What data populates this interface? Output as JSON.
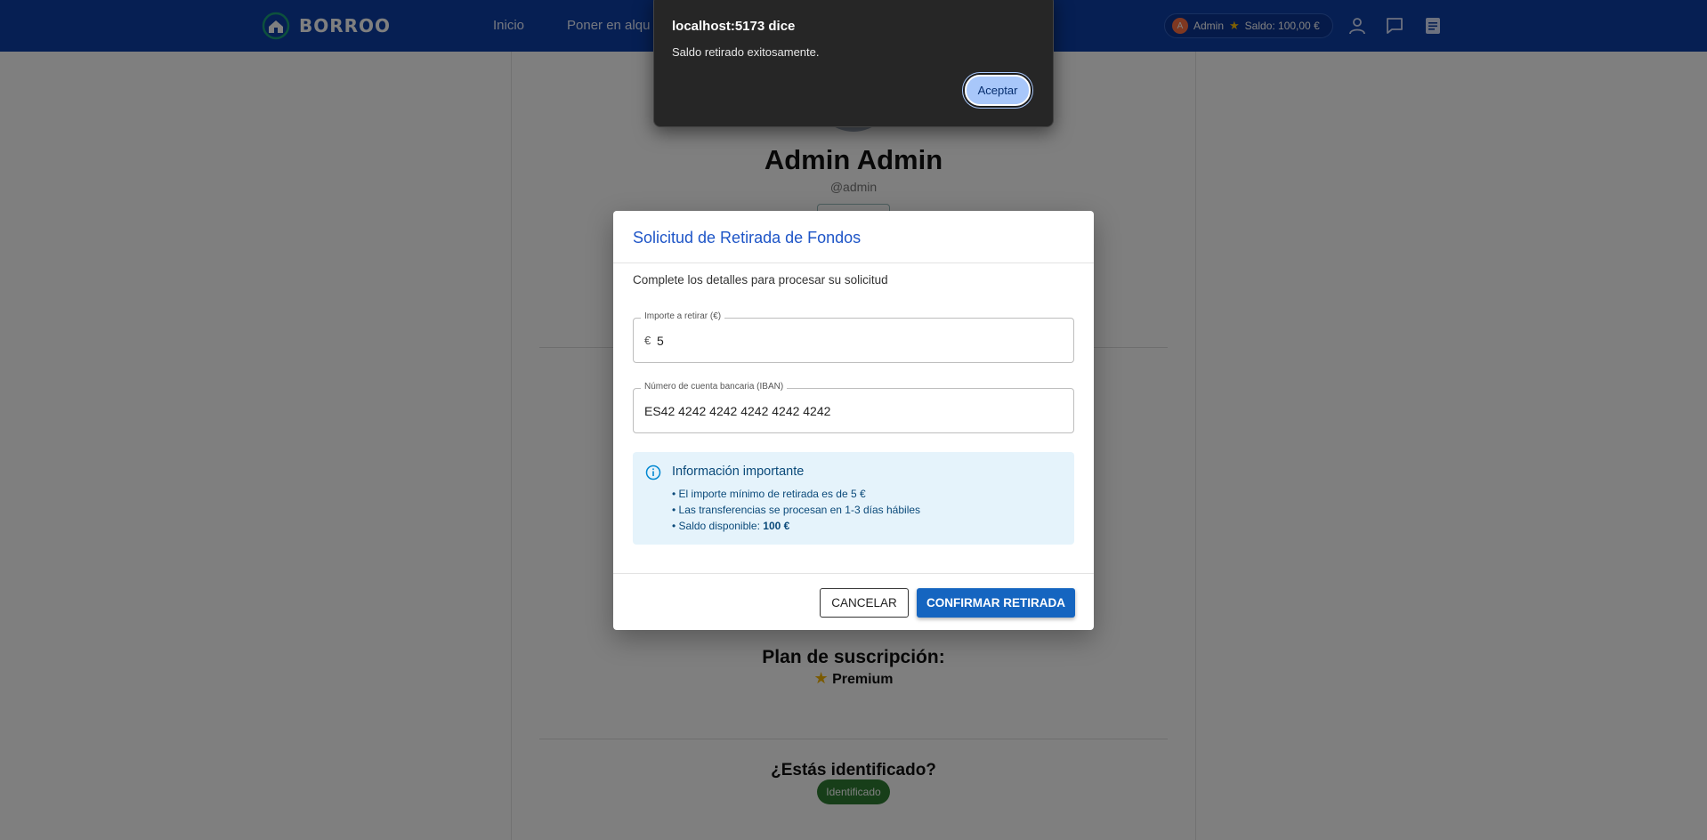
{
  "navbar": {
    "brand": "BORROO",
    "links": [
      "Inicio",
      "Poner en alqu"
    ],
    "user_name": "Admin",
    "balance": "Saldo: 100,00 €",
    "avatar_initial": "A"
  },
  "profile": {
    "name": "Admin Admin",
    "username": "@admin",
    "subscription_title": "Plan de suscripción:",
    "subscription_plan": "Premium",
    "verified_question": "¿Estás identificado?",
    "verified_badge": "Identificado"
  },
  "modal": {
    "title": "Solicitud de Retirada de Fondos",
    "subtitle": "Complete los detalles para procesar su solicitud",
    "amount_label": "Importe a retirar (€)",
    "amount_prefix": "€",
    "amount_value": "5",
    "iban_label": "Número de cuenta bancaria (IBAN)",
    "iban_value": "ES42 4242 4242 4242 4242 4242",
    "info_title": "Información importante",
    "info_line1": "• El importe mínimo de retirada es de 5 €",
    "info_line2": "• Las transferencias se procesan en 1-3 días hábiles",
    "info_line3_prefix": "• Saldo disponible: ",
    "info_line3_value": "100 €",
    "cancel_label": "CANCELAR",
    "confirm_label": "CONFIRMAR RETIRADA"
  },
  "alert": {
    "title": "localhost:5173 dice",
    "message": "Saldo retirado exitosamente.",
    "ok_label": "Aceptar"
  },
  "colors": {
    "navbar": "#0d3fa6",
    "primary": "#1565c0",
    "info_bg": "#e5f3fb",
    "alert_bg": "#262626",
    "alert_button": "#a8c7fa"
  }
}
